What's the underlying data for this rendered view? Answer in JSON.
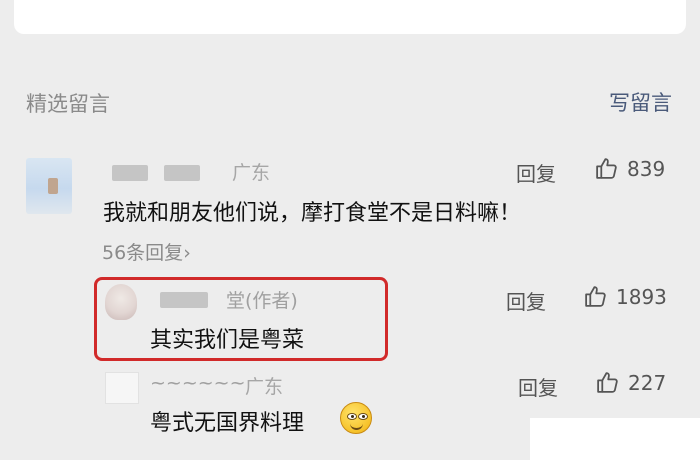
{
  "section": {
    "title": "精选留言",
    "write_label": "写留言"
  },
  "comments": [
    {
      "location": "广东",
      "reply_label": "回复",
      "likes": "839",
      "text": "我就和朋友他们说，摩打食堂不是日料嘛！",
      "replies_count": "56条回复",
      "chevron": "›"
    }
  ],
  "replies": [
    {
      "name_suffix": "堂(作者)",
      "reply_label": "回复",
      "likes": "1893",
      "text": "其实我们是粤菜"
    },
    {
      "name": "~~~~~~",
      "location": "广东",
      "reply_label": "回复",
      "likes": "227",
      "text": "粤式无国界料理"
    }
  ]
}
